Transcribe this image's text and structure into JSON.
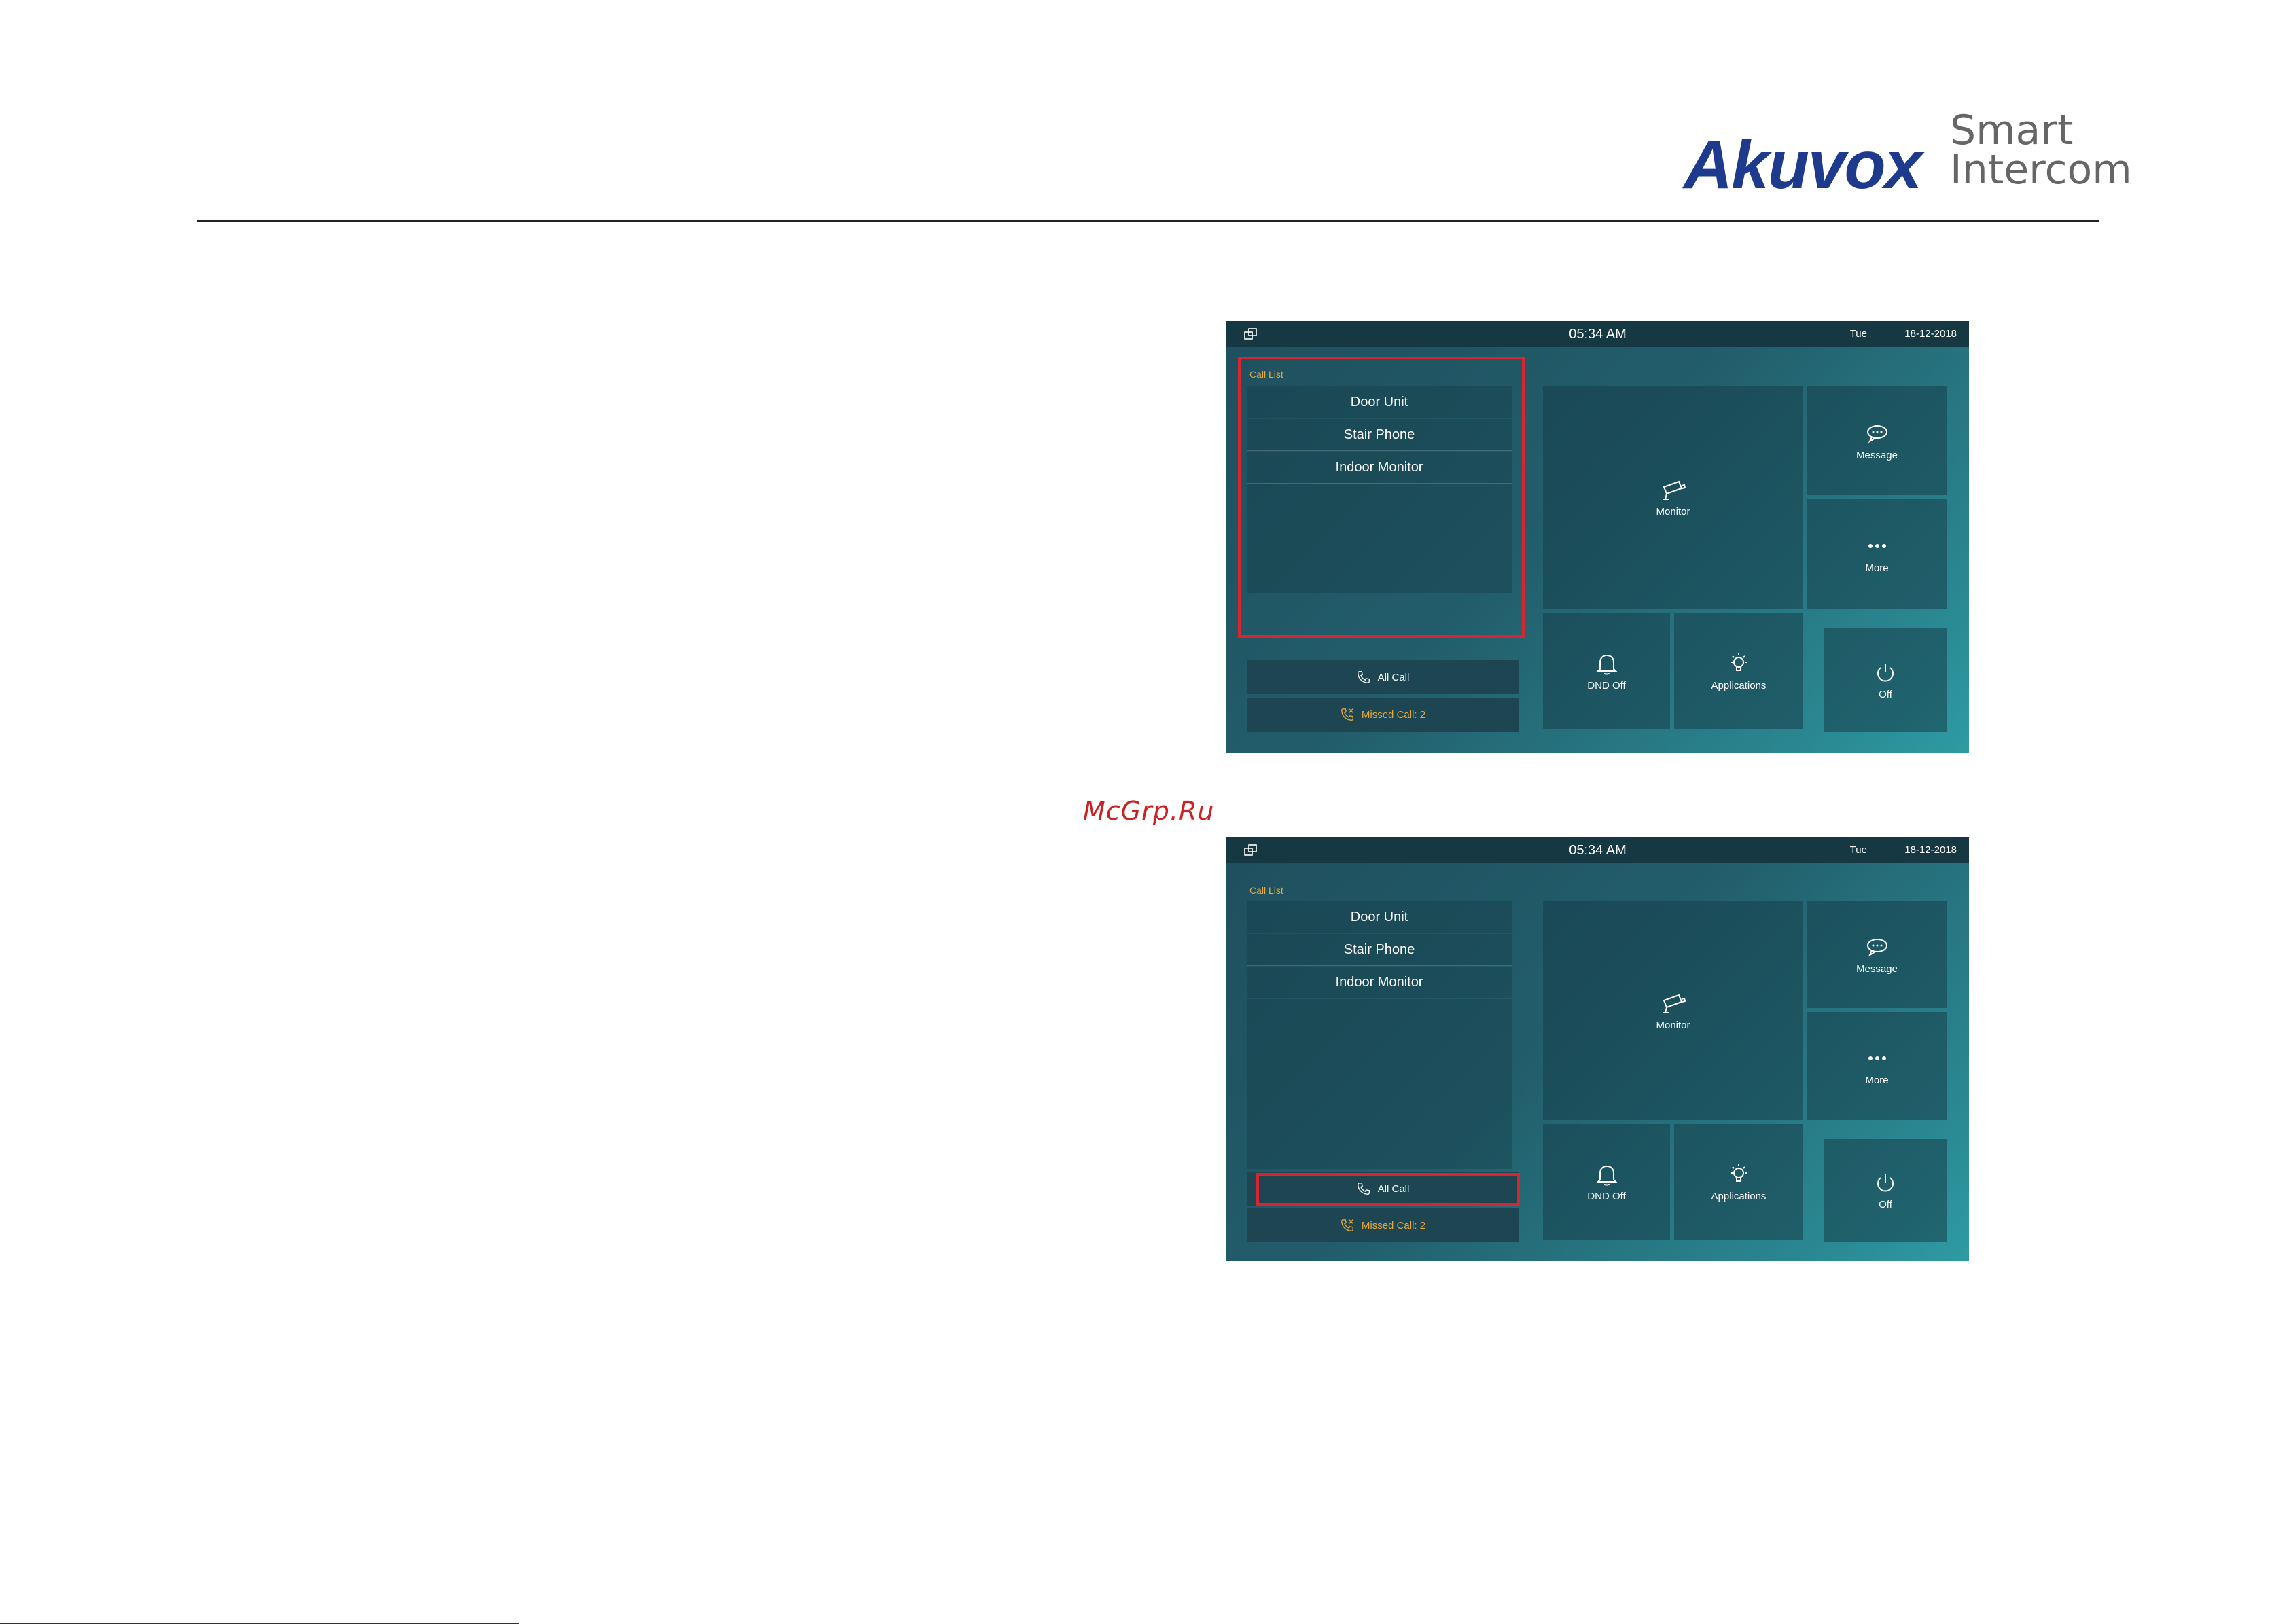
{
  "header": {
    "brand": "Akuvox",
    "tagline_line1": "Smart",
    "tagline_line2": "Intercom"
  },
  "watermark": "McGrp.Ru",
  "screens": [
    {
      "status": {
        "time": "05:34 AM",
        "day": "Tue",
        "date": "18-12-2018"
      },
      "call_list": {
        "label": "Call List",
        "items": [
          "Door Unit",
          "Stair Phone",
          "Indoor Monitor"
        ]
      },
      "buttons": {
        "all_call": "All Call",
        "missed_call": "Missed Call: 2"
      },
      "tiles": {
        "monitor": "Monitor",
        "message": "Message",
        "more": "More",
        "dnd": "DND Off",
        "applications": "Applications",
        "off": "Off"
      },
      "highlight": "call-list"
    },
    {
      "status": {
        "time": "05:34 AM",
        "day": "Tue",
        "date": "18-12-2018"
      },
      "call_list": {
        "label": "Call List",
        "items": [
          "Door Unit",
          "Stair Phone",
          "Indoor Monitor"
        ]
      },
      "buttons": {
        "all_call": "All Call",
        "missed_call": "Missed Call: 2"
      },
      "tiles": {
        "monitor": "Monitor",
        "message": "Message",
        "more": "More",
        "dnd": "DND Off",
        "applications": "Applications",
        "off": "Off"
      },
      "highlight": "all-call-button"
    }
  ],
  "colors": {
    "brand": "#1e3a8c",
    "highlight": "#d8252f",
    "missed": "#e5a93b",
    "screen_bg": "#225d6b"
  }
}
